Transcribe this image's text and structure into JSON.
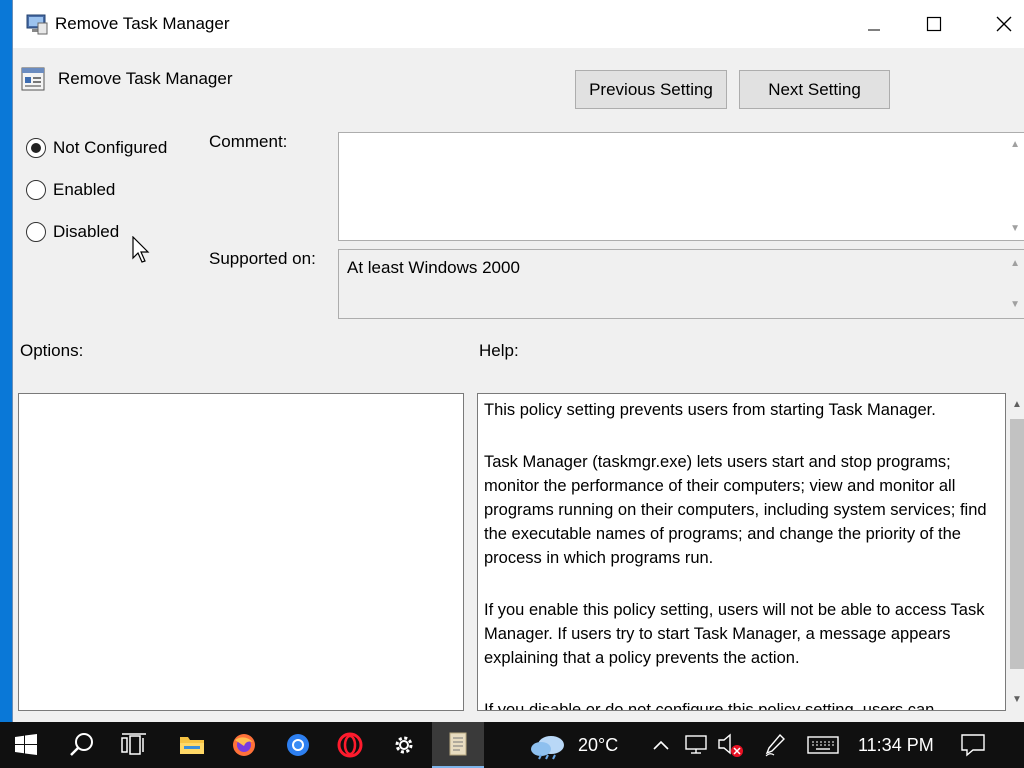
{
  "window": {
    "title": "Remove Task Manager",
    "controls": [
      "minimize-icon",
      "maximize-icon",
      "close-icon"
    ]
  },
  "policy": {
    "title": "Remove Task Manager",
    "previous_label": "Previous Setting",
    "next_label": "Next Setting"
  },
  "state": {
    "options": [
      {
        "label": "Not Configured",
        "selected": true
      },
      {
        "label": "Enabled",
        "selected": false
      },
      {
        "label": "Disabled",
        "selected": false
      }
    ]
  },
  "comment": {
    "label": "Comment:",
    "value": ""
  },
  "supported": {
    "label": "Supported on:",
    "value": "At least Windows 2000"
  },
  "options_label": "Options:",
  "help": {
    "label": "Help:",
    "paragraphs": [
      "This policy setting prevents users from starting Task Manager.",
      "Task Manager (taskmgr.exe) lets users start and stop programs; monitor the performance of their computers; view and monitor all programs running on their computers, including system services; find the executable names of programs; and change the priority of the process in which programs run.",
      "If you enable this policy setting, users will not be able to access Task Manager. If users try to start Task Manager, a message appears explaining that a policy prevents the action.",
      "If you disable or do not configure this policy setting, users can"
    ]
  },
  "taskbar": {
    "weather_temp": "20°C",
    "clock": "11:34 PM",
    "icons": [
      "windows-start-icon",
      "search-icon",
      "task-view-icon",
      "file-explorer-icon",
      "firefox-icon",
      "chrome-icon",
      "opera-icon",
      "settings-icon",
      "policy-editor-icon",
      "weather-cloud-icon",
      "chevron-up-icon",
      "network-icon",
      "volume-muted-icon",
      "pen-icon",
      "keyboard-icon",
      "notification-icon"
    ]
  },
  "colors": {
    "window_bg": "#f0f0f0",
    "desktop": "#0a78d7",
    "taskbar": "#101010",
    "button_bg": "#e1e1e1",
    "error_red": "#e81123"
  }
}
